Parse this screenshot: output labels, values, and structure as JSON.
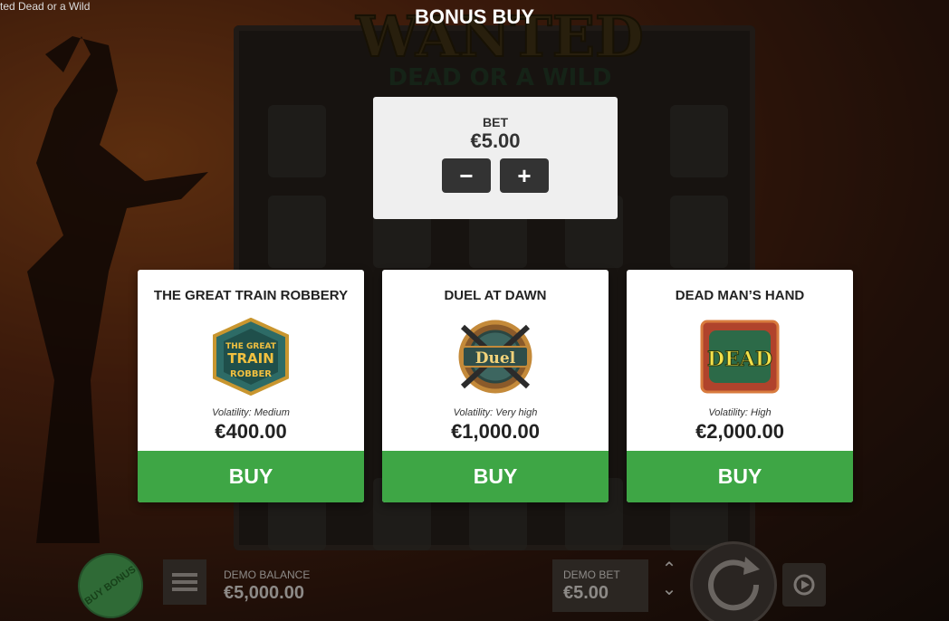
{
  "window": {
    "title_fragment": "ted Dead or a Wild"
  },
  "bonus_buy": {
    "title": "BONUS BUY",
    "bet_label": "BET",
    "bet_value": "€5.00",
    "minus_label": "−",
    "plus_label": "+"
  },
  "cards": [
    {
      "title": "THE GREAT TRAIN ROBBERY",
      "volatility": "Volatility: Medium",
      "price": "€400.00",
      "buy_label": "BUY",
      "badge_text": "THE GREAT TRAIN ROBBER"
    },
    {
      "title": "DUEL AT DAWN",
      "volatility": "Volatility: Very high",
      "price": "€1,000.00",
      "buy_label": "BUY",
      "badge_text": "Duel"
    },
    {
      "title": "DEAD MAN’S HAND",
      "volatility": "Volatility: High",
      "price": "€2,000.00",
      "buy_label": "BUY",
      "badge_text": "DEAD"
    }
  ],
  "bottom_bar": {
    "buy_bonus_label": "BUY BONUS",
    "demo_balance_label": "DEMO BALANCE",
    "demo_balance_value": "€5,000.00",
    "demo_bet_label": "DEMO BET",
    "demo_bet_value": "€5.00"
  },
  "logo": {
    "line1": "WANTED",
    "line2": "DEAD OR A WILD"
  },
  "colors": {
    "buy_green": "#3ea645",
    "panel_bg": "#efefef",
    "dark_button": "#333333"
  }
}
